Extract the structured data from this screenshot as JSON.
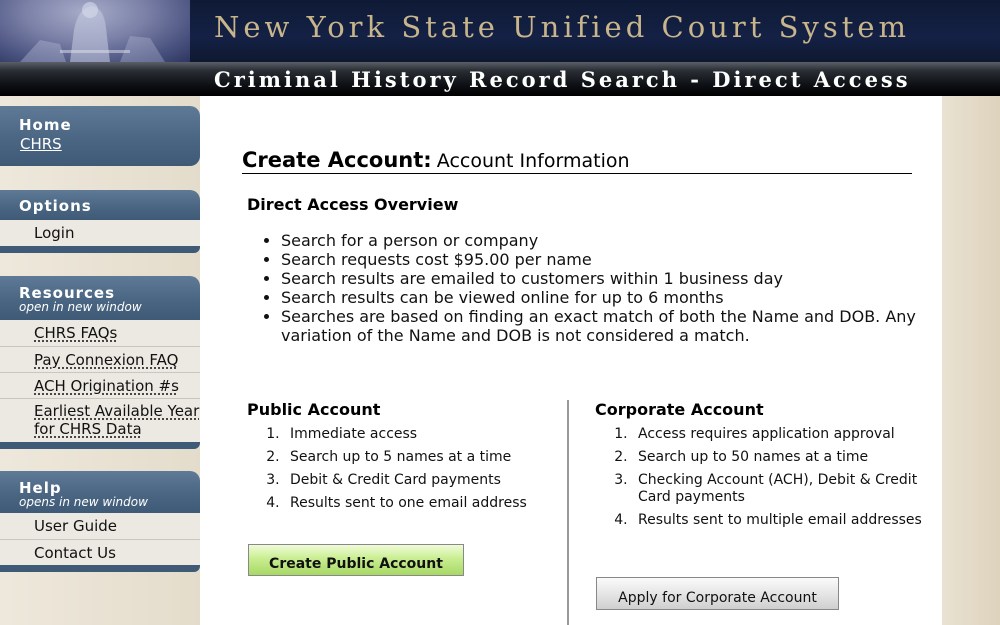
{
  "header": {
    "site_title": "New York State Unified Court System",
    "sub_title": "Criminal History Record Search - Direct Access"
  },
  "sidebar": {
    "home": {
      "title": "Home",
      "link": "CHRS"
    },
    "options": {
      "title": "Options",
      "items": [
        "Login"
      ]
    },
    "resources": {
      "title": "Resources",
      "note": "open in new window",
      "items": [
        "CHRS FAQs",
        "Pay Connexion FAQ",
        "ACH Origination #s",
        "Earliest Available Year for CHRS Data"
      ]
    },
    "help": {
      "title": "Help",
      "note": "opens in new window",
      "items": [
        "User Guide",
        "Contact Us"
      ]
    }
  },
  "main": {
    "title_bold": "Create Account:",
    "title_rest": "Account Information",
    "overview_heading": "Direct Access Overview",
    "overview_items": [
      "Search for a person or company",
      "Search requests cost $95.00 per name",
      "Search results are emailed to customers within 1 business day",
      "Search results can be viewed online for up to 6 months",
      "Searches are based on finding an exact match of both the Name and DOB. Any variation of the Name and DOB is not considered a match."
    ],
    "public": {
      "heading": "Public Account",
      "items": [
        "Immediate access",
        "Search up to 5 names at a time",
        "Debit & Credit Card payments",
        "Results sent to one email address"
      ],
      "button": "Create Public Account"
    },
    "corporate": {
      "heading": "Corporate Account",
      "items": [
        "Access requires application approval",
        "Search up to 50 names at a time",
        "Checking Account (ACH), Debit & Credit Card payments",
        "Results sent to multiple email addresses"
      ],
      "button": "Apply for Corporate Account"
    }
  }
}
